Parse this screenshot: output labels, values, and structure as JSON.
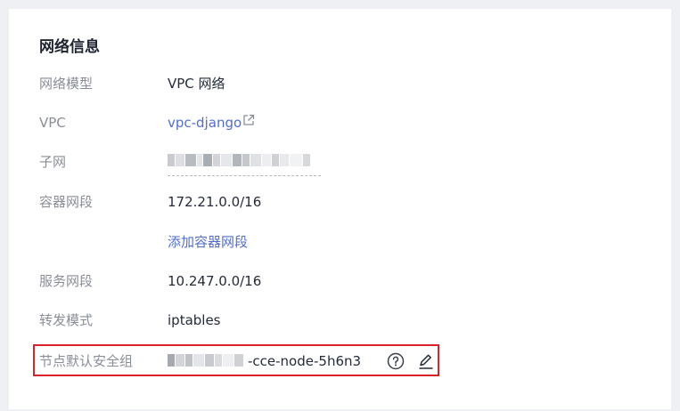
{
  "section": {
    "title": "网络信息"
  },
  "rows": {
    "network_model": {
      "label": "网络模型",
      "value": "VPC 网络"
    },
    "vpc": {
      "label": "VPC",
      "value": "vpc-django"
    },
    "subnet": {
      "label": "子网"
    },
    "container_cidr": {
      "label": "容器网段",
      "value": "172.21.0.0/16",
      "add_link": "添加容器网段"
    },
    "service_cidr": {
      "label": "服务网段",
      "value": "10.247.0.0/16"
    },
    "forward_mode": {
      "label": "转发模式",
      "value": "iptables"
    },
    "security_group": {
      "label": "节点默认安全组",
      "value_suffix": "-cce-node-5h6n3"
    }
  },
  "icons": {
    "external_link": "external-link-icon",
    "help": "question-circle-icon",
    "edit": "pencil-edit-icon"
  },
  "colors": {
    "link": "#526ecc",
    "highlight_border": "#d8232a",
    "label": "#8a8e99"
  }
}
